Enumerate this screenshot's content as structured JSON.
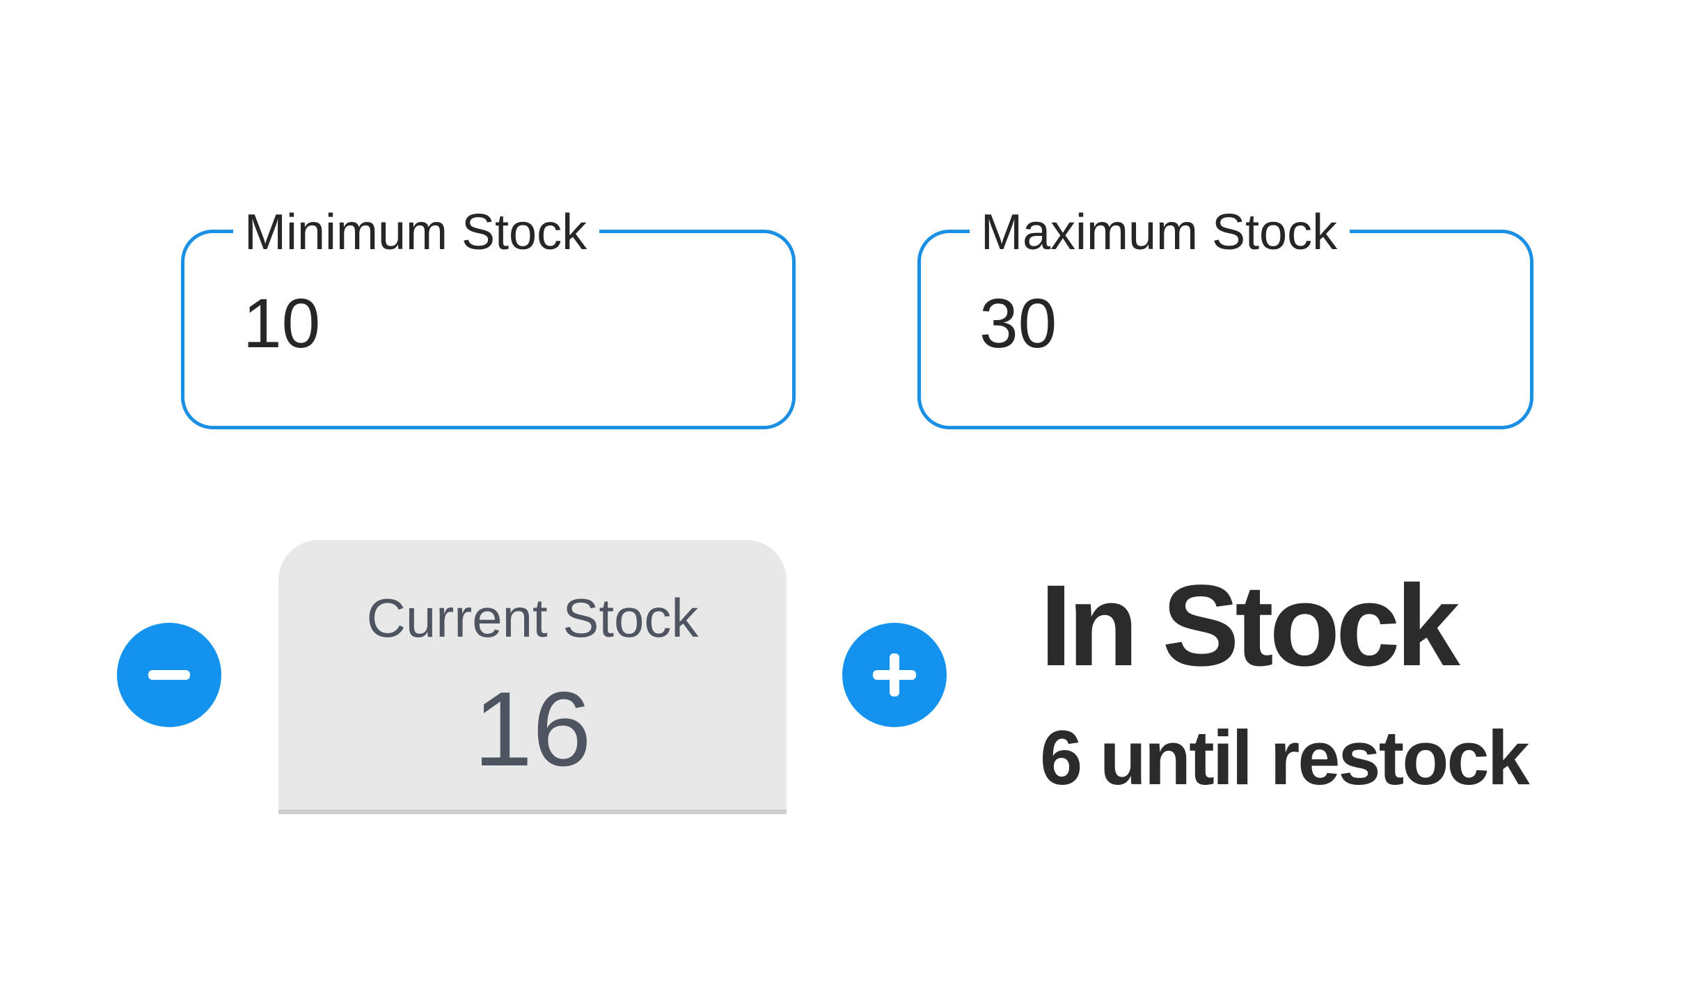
{
  "min_stock": {
    "label": "Minimum Stock",
    "value": "10"
  },
  "max_stock": {
    "label": "Maximum Stock",
    "value": "30"
  },
  "current_stock": {
    "label": "Current Stock",
    "value": "16"
  },
  "buttons": {
    "decrement_icon": "minus-icon",
    "increment_icon": "plus-icon"
  },
  "status": {
    "title": "In Stock",
    "subtitle": "6 until restock"
  },
  "colors": {
    "accent": "#1493ee",
    "outline": "#1a8fe3",
    "filled_background": "#e8e8e8",
    "text": "#2b2b2b",
    "muted_text": "#4e5561"
  }
}
